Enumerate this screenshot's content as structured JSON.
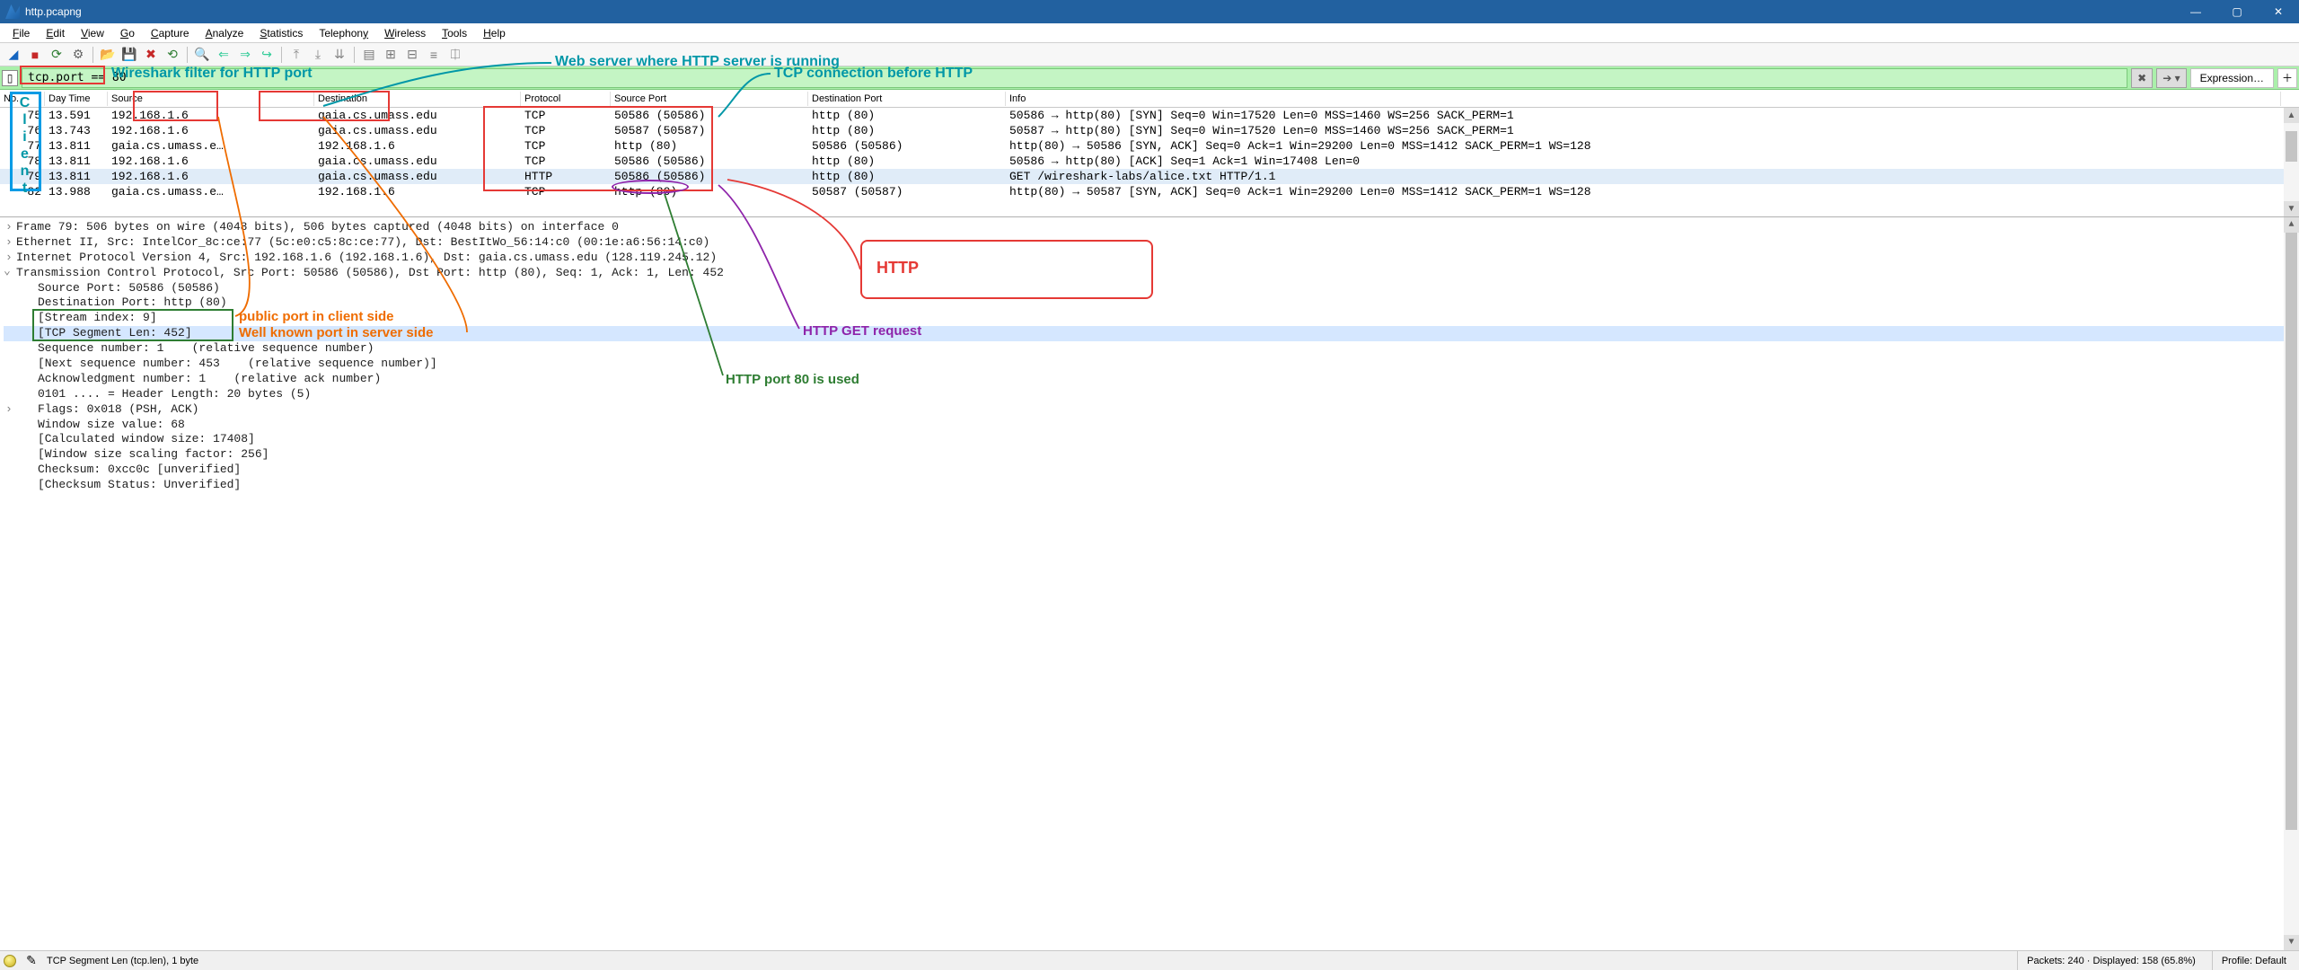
{
  "title": "http.pcapng",
  "menu": [
    "File",
    "Edit",
    "View",
    "Go",
    "Capture",
    "Analyze",
    "Statistics",
    "Telephony",
    "Wireless",
    "Tools",
    "Help"
  ],
  "filter": {
    "value": "tcp.port == 80",
    "expression_label": "Expression…"
  },
  "columns": [
    "No.",
    "Day Time",
    "Source",
    "Destination",
    "Protocol",
    "Source Port",
    "Destination Port",
    "Info"
  ],
  "packets": [
    {
      "no": "75",
      "time": "13.591",
      "src": "192.168.1.6",
      "dst": "gaia.cs.umass.edu",
      "proto": "TCP",
      "sport": "50586 (50586)",
      "dport": "http (80)",
      "info": "50586 → http(80) [SYN] Seq=0 Win=17520 Len=0 MSS=1460 WS=256 SACK_PERM=1"
    },
    {
      "no": "76",
      "time": "13.743",
      "src": "192.168.1.6",
      "dst": "gaia.cs.umass.edu",
      "proto": "TCP",
      "sport": "50587 (50587)",
      "dport": "http (80)",
      "info": "50587 → http(80) [SYN] Seq=0 Win=17520 Len=0 MSS=1460 WS=256 SACK_PERM=1"
    },
    {
      "no": "77",
      "time": "13.811",
      "src": "gaia.cs.umass.e…",
      "dst": "192.168.1.6",
      "proto": "TCP",
      "sport": "http (80)",
      "dport": "50586 (50586)",
      "info": "http(80) → 50586 [SYN, ACK] Seq=0 Ack=1 Win=29200 Len=0 MSS=1412 SACK_PERM=1 WS=128"
    },
    {
      "no": "78",
      "time": "13.811",
      "src": "192.168.1.6",
      "dst": "gaia.cs.umass.edu",
      "proto": "TCP",
      "sport": "50586 (50586)",
      "dport": "http (80)",
      "info": "50586 → http(80) [ACK] Seq=1 Ack=1 Win=17408 Len=0"
    },
    {
      "no": "79",
      "time": "13.811",
      "src": "192.168.1.6",
      "dst": "gaia.cs.umass.edu",
      "proto": "HTTP",
      "sport": "50586 (50586)",
      "dport": "http (80)",
      "info": "GET /wireshark-labs/alice.txt HTTP/1.1"
    },
    {
      "no": "82",
      "time": "13.988",
      "src": "gaia.cs.umass.e…",
      "dst": "192.168.1.6",
      "proto": "TCP",
      "sport": "http (80)",
      "dport": "50587 (50587)",
      "info": "http(80) → 50587 [SYN, ACK] Seq=0 Ack=1 Win=29200 Len=0 MSS=1412 SACK_PERM=1 WS=128"
    }
  ],
  "details": [
    {
      "indent": 0,
      "toggle": "closed",
      "text": "Frame 79: 506 bytes on wire (4048 bits), 506 bytes captured (4048 bits) on interface 0"
    },
    {
      "indent": 0,
      "toggle": "closed",
      "text": "Ethernet II, Src: IntelCor_8c:ce:77 (5c:e0:c5:8c:ce:77), Dst: BestItWo_56:14:c0 (00:1e:a6:56:14:c0)"
    },
    {
      "indent": 0,
      "toggle": "closed",
      "text": "Internet Protocol Version 4, Src: 192.168.1.6 (192.168.1.6), Dst: gaia.cs.umass.edu (128.119.245.12)"
    },
    {
      "indent": 0,
      "toggle": "open",
      "text": "Transmission Control Protocol, Src Port: 50586 (50586), Dst Port: http (80), Seq: 1, Ack: 1, Len: 452"
    },
    {
      "indent": 1,
      "text": "Source Port: 50586 (50586)"
    },
    {
      "indent": 1,
      "text": "Destination Port: http (80)"
    },
    {
      "indent": 1,
      "text": "[Stream index: 9]"
    },
    {
      "indent": 1,
      "text": "[TCP Segment Len: 452]",
      "sel": true
    },
    {
      "indent": 1,
      "text": "Sequence number: 1    (relative sequence number)"
    },
    {
      "indent": 1,
      "text": "[Next sequence number: 453    (relative sequence number)]"
    },
    {
      "indent": 1,
      "text": "Acknowledgment number: 1    (relative ack number)"
    },
    {
      "indent": 1,
      "text": "0101 .... = Header Length: 20 bytes (5)"
    },
    {
      "indent": 1,
      "toggle": "closed",
      "text": "Flags: 0x018 (PSH, ACK)"
    },
    {
      "indent": 1,
      "text": "Window size value: 68"
    },
    {
      "indent": 1,
      "text": "[Calculated window size: 17408]"
    },
    {
      "indent": 1,
      "text": "[Window size scaling factor: 256]"
    },
    {
      "indent": 1,
      "text": "Checksum: 0xcc0c [unverified]"
    },
    {
      "indent": 1,
      "text": "[Checksum Status: Unverified]"
    }
  ],
  "status": {
    "field": "TCP Segment Len (tcp.len), 1 byte",
    "packets": "Packets: 240 · Displayed: 158 (65.8%)",
    "profile": "Profile: Default"
  },
  "annotations": {
    "web_server": "Web server where HTTP server is running",
    "filter": "Wireshark filter for HTTP port",
    "tcp_conn": "TCP connection before HTTP",
    "client": "Client",
    "src_port": "public port in client side",
    "dst_port": "Well known port in server side",
    "http_big": "HTTP",
    "http_port": "HTTP port 80 is used",
    "http_get": "HTTP GET request"
  }
}
